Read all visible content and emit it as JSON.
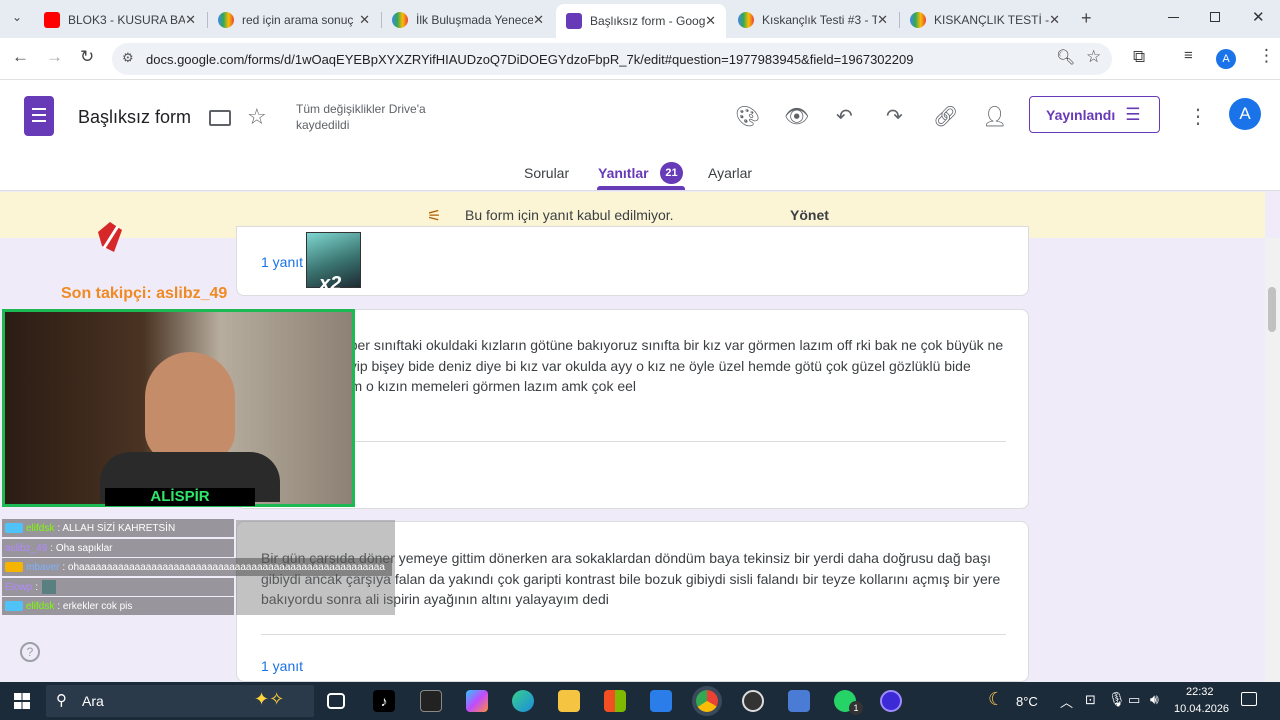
{
  "browser": {
    "tabs": [
      {
        "title": "BLOK3 - KUSURA BA",
        "color": "#ff0000"
      },
      {
        "title": "red için arama sonuç",
        "color": "#4285f4"
      },
      {
        "title": "İlk Buluşmada Yenece",
        "color": "#4285f4"
      },
      {
        "title": "Başlıksız form - Goog",
        "color": "#673ab7"
      },
      {
        "title": "Kıskançlık Testi #3 - T",
        "color": "#4285f4"
      },
      {
        "title": "KISKANÇLIK TESTİ -_",
        "color": "#4285f4"
      }
    ],
    "close_glyph": "✕",
    "new_tab": "+",
    "url": "docs.google.com/forms/d/1wOaqEYEBpXYXZRYifHIAUDzoQ7DiDOEGYdzoFbpR_7k/edit#question=1977983945&field=1967302209",
    "profile_initial": "A"
  },
  "form": {
    "title": "Başlıksız form",
    "save_status": "Tüm değişiklikler Drive'a kaydedildi",
    "publish_button": "Yayınlandı",
    "avatar_initial": "A",
    "tabs": {
      "questions": "Sorular",
      "responses": "Yanıtlar",
      "responses_count": "21",
      "settings": "Ayarlar"
    },
    "banner": {
      "text": "Bu form için yanıt kabul edilmiyor.",
      "action": "Yönet"
    },
    "cards": [
      {
        "answer_count": "1 yanıt"
      },
      {
        "text": "adaşlarla beraber sınıftaki okuldaki kızların götüne bakıyoruz sınıfta bir kız var görmen lazım off rki bak ne çok büyük ne çok küçük acayip bişey bide deniz diye bi kız var okulda ayy o kız ne öyle üzel hemde götü çok güzel gözlüklü bide sınıftaki dediğim o kızın memeleri görmen lazım amk çok eel"
      },
      {
        "text": "Bir gün çarşıda döner yemeye gittim dönerken ara sokaklardan döndüm baya tekinsiz bir yerdi daha doğrusu dağ başı gibiydi ancak çarşıya falan da yakındı çok garipti kontrast bile bozuk gibiydi sisli falandı bir teyze kollarını açmış bir yere bakıyordu sonra ali ispirin ayağının altını yalayayım dedi",
        "answer_count": "1 yanıt"
      }
    ],
    "help_glyph": "?"
  },
  "stream": {
    "follower_text": "Son takipçi: aslibz_49",
    "sticker_badge": "x2",
    "webcam_name": "ALİSPİR",
    "chat": [
      {
        "user": "elifdsk",
        "message": ": ALLAH SİZİ KAHRETSİN",
        "user_color": "#7cfc00"
      },
      {
        "user": "aslibz_49",
        "message": ": Oha sapıklar",
        "user_color": "#b388ff"
      },
      {
        "user": "mbaver",
        "message": ": ohaaaaaaaaaaaaaaaaaaaaaaaaaaaaaaaaaaaaaaaaaaaaaaaaaaaaaaa",
        "user_color": "#7fb0ff"
      },
      {
        "user": "Elowp",
        "message": ":",
        "user_color": "#b388ff"
      },
      {
        "user": "elifdsk",
        "message": ": erkekler cok pis",
        "user_color": "#7cfc00"
      }
    ]
  },
  "taskbar": {
    "search_placeholder": "Ara",
    "temperature": "8°C",
    "time": "22:32",
    "date": "10.04.2026",
    "whatsapp_badge": "1"
  }
}
